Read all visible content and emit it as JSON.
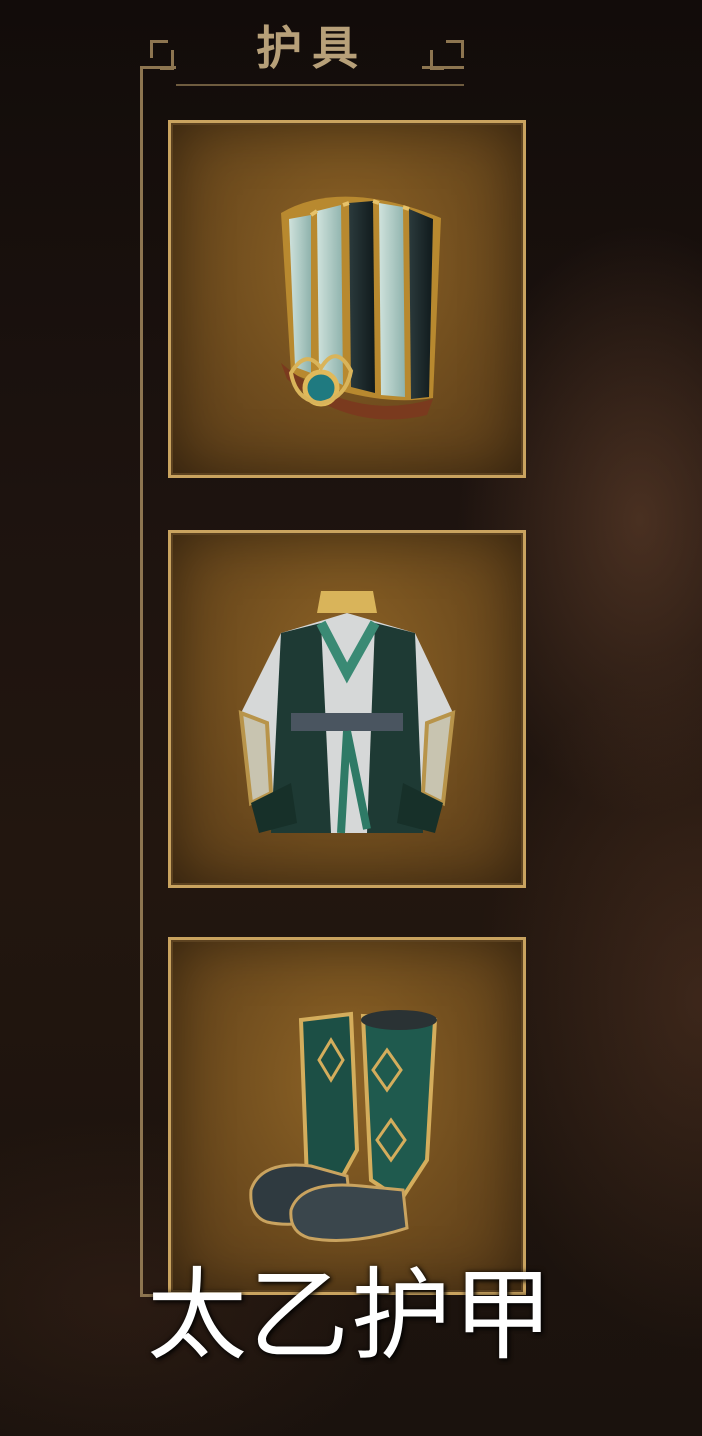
{
  "section": {
    "title": "护具"
  },
  "slots": [
    {
      "name": "helmet",
      "icon": "helmet-icon"
    },
    {
      "name": "robe",
      "icon": "robe-icon"
    },
    {
      "name": "boots",
      "icon": "boots-icon"
    }
  ],
  "caption": {
    "text": "太乙护甲"
  },
  "colors": {
    "frame": "#8d7550",
    "slot_border": "#c9a35f",
    "slot_fill": "#74501f",
    "title": "#b7a079",
    "jade": "#2f7a66",
    "caption": "#ffffff"
  }
}
